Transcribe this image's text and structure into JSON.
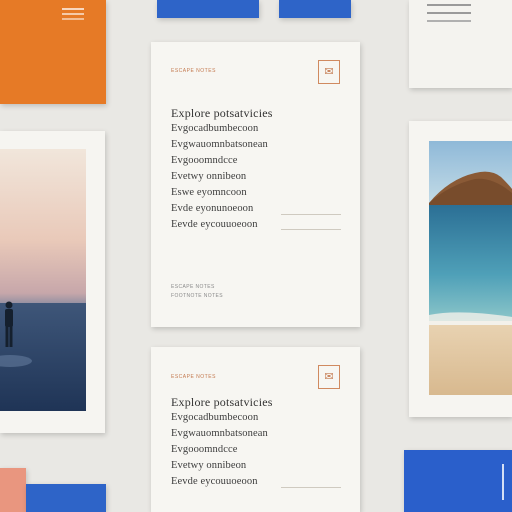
{
  "card_top": {
    "tag": "ESCAPE NOTES",
    "stamp": "✉",
    "title": "Explore potsatvicies",
    "lines": [
      "Evgocadbumbecoon",
      "Evgwauomnbatsonean",
      "Evgooomndcce",
      "Evetwy onnibeon",
      "Eswe eyomncoon",
      "Evde eyonunoeoon",
      "Eevde eycouuoeoon"
    ],
    "footer": [
      "ESCAPE NOTES",
      "FOOTNOTE NOTES"
    ]
  },
  "card_bottom": {
    "tag": "ESCAPE NOTES",
    "stamp": "✉",
    "title": "Explore potsatvicies",
    "lines": [
      "Evgocadbumbecoon",
      "Evgwauomnbatsonean",
      "Evgooomndcce",
      "Evetwy onnibeon",
      "Eevde eycouuoeoon"
    ]
  }
}
